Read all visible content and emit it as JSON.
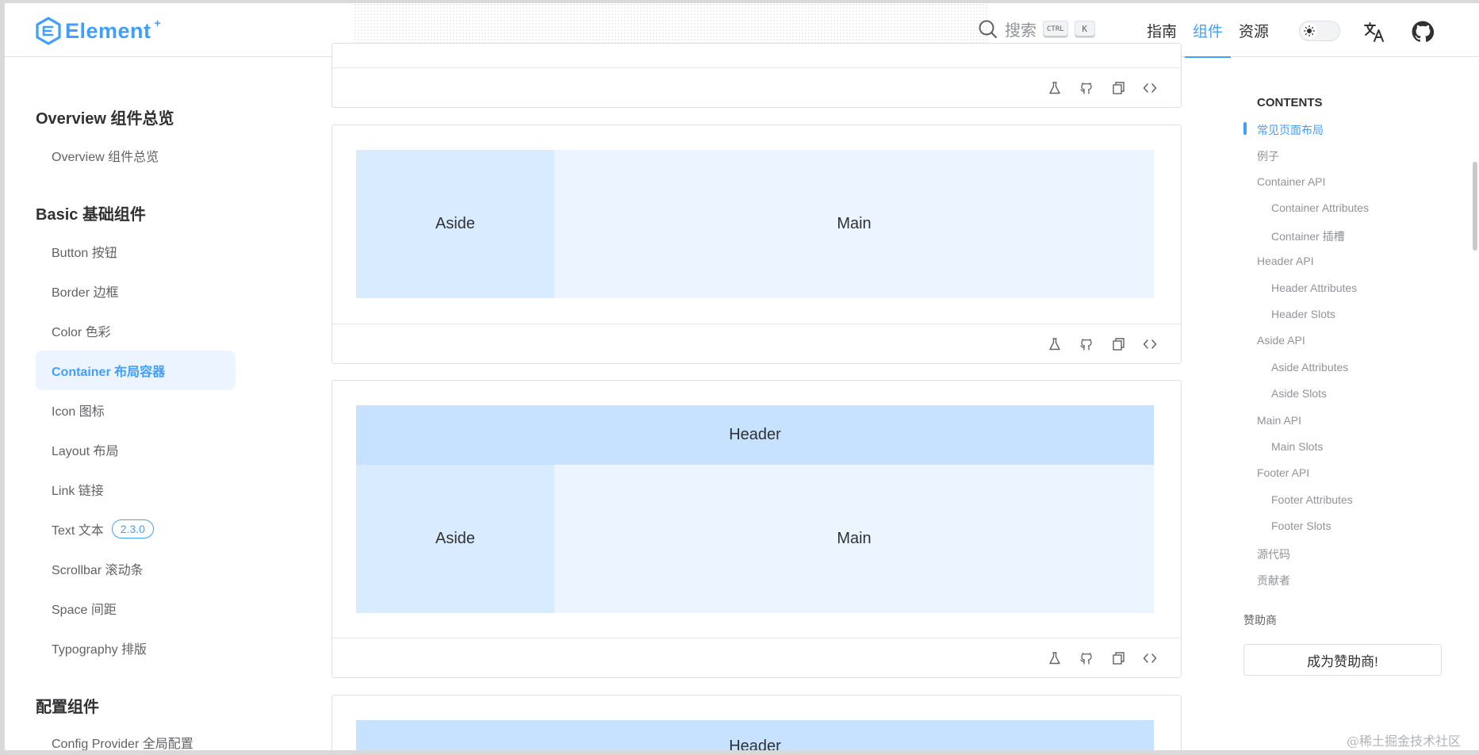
{
  "header": {
    "logo_text": "Element",
    "logo_sup": "+",
    "search_label": "搜索",
    "kbd_ctrl": "CTRL",
    "kbd_k": "K",
    "nav": [
      "指南",
      "组件",
      "资源"
    ],
    "nav_active": "组件",
    "accent_color": "#409eff"
  },
  "sidebar": {
    "groups": [
      {
        "title": "Overview 组件总览",
        "items": [
          "Overview 组件总览"
        ]
      },
      {
        "title": "Basic 基础组件",
        "items": [
          "Button 按钮",
          "Border 边框",
          "Color 色彩",
          "Container 布局容器",
          "Icon 图标",
          "Layout 布局",
          "Link 链接",
          "Text 文本",
          "Scrollbar 滚动条",
          "Space 间距",
          "Typography 排版"
        ]
      },
      {
        "title": "配置组件",
        "items": [
          "Config Provider 全局配置"
        ]
      }
    ],
    "active_item": "Container 布局容器",
    "text_badge": "2.3.0"
  },
  "demos": {
    "aside": "Aside",
    "main": "Main",
    "header": "Header"
  },
  "toc": {
    "title": "CONTENTS",
    "items": [
      {
        "label": "常见页面布局",
        "level": 1,
        "active": true
      },
      {
        "label": "例子",
        "level": 1
      },
      {
        "label": "Container API",
        "level": 1
      },
      {
        "label": "Container Attributes",
        "level": 2
      },
      {
        "label": "Container 插槽",
        "level": 2
      },
      {
        "label": "Header API",
        "level": 1
      },
      {
        "label": "Header Attributes",
        "level": 2
      },
      {
        "label": "Header Slots",
        "level": 2
      },
      {
        "label": "Aside API",
        "level": 1
      },
      {
        "label": "Aside Attributes",
        "level": 2
      },
      {
        "label": "Aside Slots",
        "level": 2
      },
      {
        "label": "Main API",
        "level": 1
      },
      {
        "label": "Main Slots",
        "level": 2
      },
      {
        "label": "Footer API",
        "level": 1
      },
      {
        "label": "Footer Attributes",
        "level": 2
      },
      {
        "label": "Footer Slots",
        "level": 2
      },
      {
        "label": "源代码",
        "level": 1
      },
      {
        "label": "贡献者",
        "level": 1
      }
    ],
    "sponsor_label": "赞助商",
    "sponsor_button": "成为赞助商!"
  },
  "watermark": "@稀土掘金技术社区",
  "icons": {
    "demo_toolbar": [
      "flask-icon",
      "github-icon",
      "copy-icon",
      "code-icon"
    ],
    "header": [
      "search-icon",
      "sun-icon",
      "translate-icon",
      "github-icon"
    ]
  }
}
